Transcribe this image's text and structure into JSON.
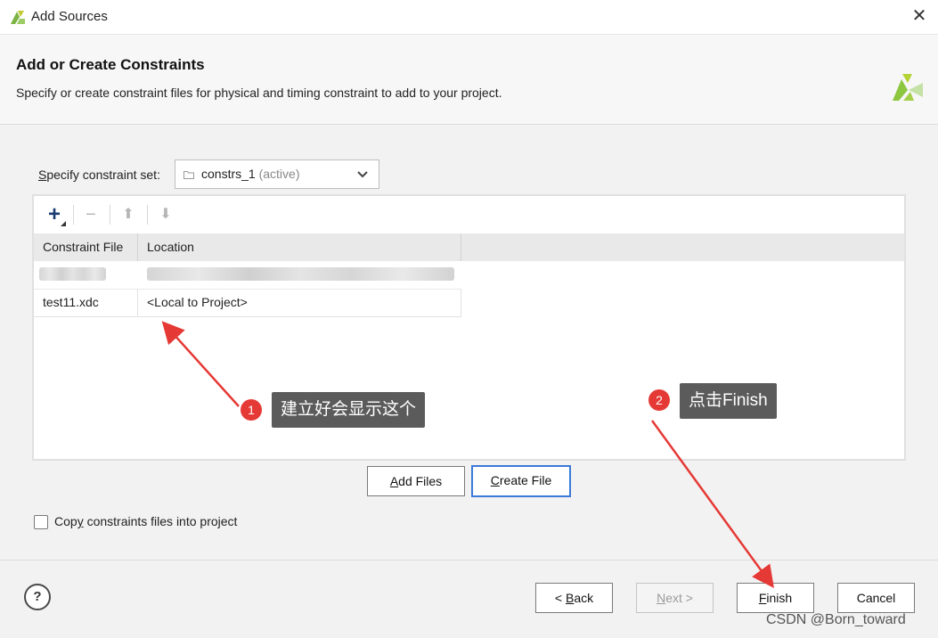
{
  "window": {
    "title": "Add Sources",
    "close_glyph": "✕"
  },
  "header": {
    "title": "Add or Create Constraints",
    "description": "Specify or create constraint files for physical and timing constraint to add to your project."
  },
  "constraint_set": {
    "label_accel": "S",
    "label_rest": "pecify constraint set:",
    "value": "constrs_1",
    "status": "(active)"
  },
  "toolbar": {
    "add_glyph": "+",
    "remove_glyph": "−",
    "up_glyph": "⬆",
    "down_glyph": "⬇"
  },
  "table": {
    "headers": [
      "Constraint File",
      "Location"
    ],
    "rows": [
      {
        "file": "test11.xdc",
        "location": "<Local to Project>"
      }
    ]
  },
  "buttons": {
    "add_files_accel": "A",
    "add_files_rest": "dd Files",
    "create_file_accel": "C",
    "create_file_rest": "reate File",
    "back_pre": "< ",
    "back_accel": "B",
    "back_rest": "ack",
    "next_accel": "N",
    "next_rest": "ext >",
    "finish_accel": "F",
    "finish_rest": "inish",
    "cancel": "Cancel",
    "help": "?"
  },
  "copy_option": {
    "accel": "y",
    "pre": "Cop",
    "rest": " constraints files into project",
    "checked": false
  },
  "annotations": [
    {
      "number": "1",
      "text": "建立好会显示这个"
    },
    {
      "number": "2",
      "text": "点击Finish"
    }
  ],
  "watermark": "CSDN @Born_toward",
  "colors": {
    "accent": "#3b7ad9",
    "annotation_red": "#e53935",
    "callout_bg": "#5b5b5b",
    "logo_green": "#8dc63f"
  }
}
